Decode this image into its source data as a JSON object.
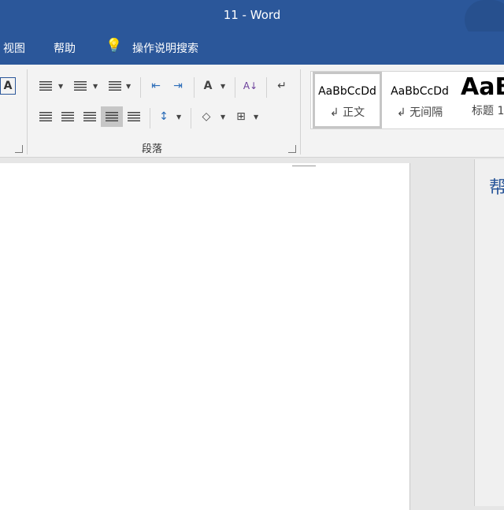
{
  "title": "11  -  Word",
  "tabs": [
    {
      "label": "视图"
    },
    {
      "label": "帮助"
    },
    {
      "label": "操作说明搜索"
    }
  ],
  "ribbon": {
    "paragraph_group_label": "段落",
    "styles": [
      {
        "preview": "AaBbCcDd",
        "name": "↲ 正文",
        "selected": true
      },
      {
        "preview": "AaBbCcDd",
        "name": "↲ 无间隔"
      },
      {
        "preview": "AaBl",
        "name": "标题 1"
      }
    ]
  },
  "pane": {
    "title": "帮"
  },
  "colors": {
    "brand": "#2b579a",
    "ribbon": "#f3f3f3"
  }
}
